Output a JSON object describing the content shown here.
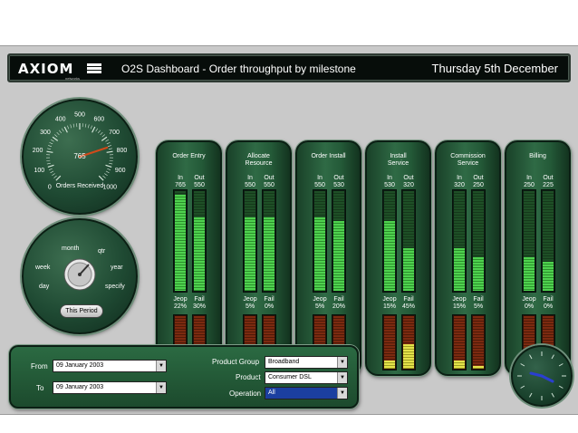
{
  "header": {
    "logo_text": "AXIOM",
    "logo_subtext": "networks",
    "title": "O2S Dashboard - Order throughput by milestone",
    "date": "Thursday 5th December"
  },
  "orders_gauge": {
    "scale": [
      "0",
      "100",
      "200",
      "300",
      "400",
      "500",
      "600",
      "700",
      "800",
      "900",
      "1000"
    ],
    "value": "765",
    "value_numeric": 765,
    "max": 1000,
    "caption": "Orders Received"
  },
  "period_dial": {
    "options": {
      "week": "week",
      "month": "month",
      "qtr": "qtr",
      "year": "year",
      "day": "day",
      "specify": "specify"
    },
    "button_label": "This Period"
  },
  "milestones": [
    {
      "title_line1": "Order Entry",
      "title_line2": "",
      "in_label": "In",
      "out_label": "Out",
      "in_value": "765",
      "out_value": "550",
      "jeop_label": "Jeop",
      "fail_label": "Fail",
      "jeop_value": "22%",
      "fail_value": "30%",
      "in_level": 0.95,
      "out_level": 0.72,
      "jeop_level": 0.22,
      "fail_level": 0.3
    },
    {
      "title_line1": "Allocate",
      "title_line2": "Resource",
      "in_label": "In",
      "out_label": "Out",
      "in_value": "550",
      "out_value": "550",
      "jeop_label": "Jeop",
      "fail_label": "Fail",
      "jeop_value": "5%",
      "fail_value": "0%",
      "in_level": 0.72,
      "out_level": 0.72,
      "jeop_level": 0.05,
      "fail_level": 0.0
    },
    {
      "title_line1": "Order Install",
      "title_line2": "",
      "in_label": "In",
      "out_label": "Out",
      "in_value": "550",
      "out_value": "530",
      "jeop_label": "Jeop",
      "fail_label": "Fail",
      "jeop_value": "5%",
      "fail_value": "20%",
      "in_level": 0.72,
      "out_level": 0.69,
      "jeop_level": 0.05,
      "fail_level": 0.2
    },
    {
      "title_line1": "Install",
      "title_line2": "Service",
      "in_label": "In",
      "out_label": "Out",
      "in_value": "530",
      "out_value": "320",
      "jeop_label": "Jeop",
      "fail_label": "Fail",
      "jeop_value": "15%",
      "fail_value": "45%",
      "in_level": 0.69,
      "out_level": 0.42,
      "jeop_level": 0.15,
      "fail_level": 0.45
    },
    {
      "title_line1": "Commission",
      "title_line2": "Service",
      "in_label": "In",
      "out_label": "Out",
      "in_value": "320",
      "out_value": "250",
      "jeop_label": "Jeop",
      "fail_label": "Fail",
      "jeop_value": "15%",
      "fail_value": "5%",
      "in_level": 0.42,
      "out_level": 0.33,
      "jeop_level": 0.15,
      "fail_level": 0.05
    },
    {
      "title_line1": "Billing",
      "title_line2": "",
      "in_label": "In",
      "out_label": "Out",
      "in_value": "250",
      "out_value": "225",
      "jeop_label": "Jeop",
      "fail_label": "Fail",
      "jeop_value": "0%",
      "fail_value": "0%",
      "in_level": 0.33,
      "out_level": 0.29,
      "jeop_level": 0.0,
      "fail_level": 0.0
    }
  ],
  "filters": {
    "from_label": "From",
    "to_label": "To",
    "from_value": "09 January 2003",
    "to_value": "09 January 2003",
    "product_group_label": "Product Group",
    "product_group_value": "Broadband",
    "product_label": "Product",
    "product_value": "Consumer DSL",
    "operation_label": "Operation",
    "operation_value": "All"
  },
  "colors": {
    "panel_green": "#2f6a45",
    "bar_green": "#4fd24f",
    "bar_yellow": "#e3e24a",
    "bar_red": "#7c2a10",
    "header_bg": "#070d0a",
    "selection_blue": "#1b3fa0"
  }
}
